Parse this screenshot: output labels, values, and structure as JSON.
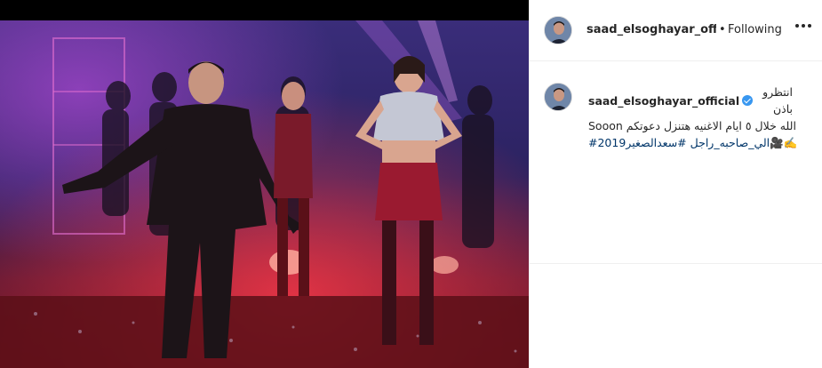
{
  "post": {
    "author": "saad_elsoghayar_official",
    "follow_separator": "•",
    "follow_state": "Following",
    "caption_author": "saad_elsoghayar_official",
    "caption_line1": "انتظرو باذن",
    "caption_line2": "Sooon الله خلال ٥ ايام الاغنيه هتنزل دعوتكم",
    "caption_tags": "#الي_صاحبه_راجل #سعدالصغير2019🎥✍️"
  },
  "colors": {
    "verified": "#3897f0",
    "hashtag": "#003569",
    "text": "#262626"
  },
  "icons": {
    "more": "more-options-icon",
    "verified": "verified-badge-icon"
  }
}
